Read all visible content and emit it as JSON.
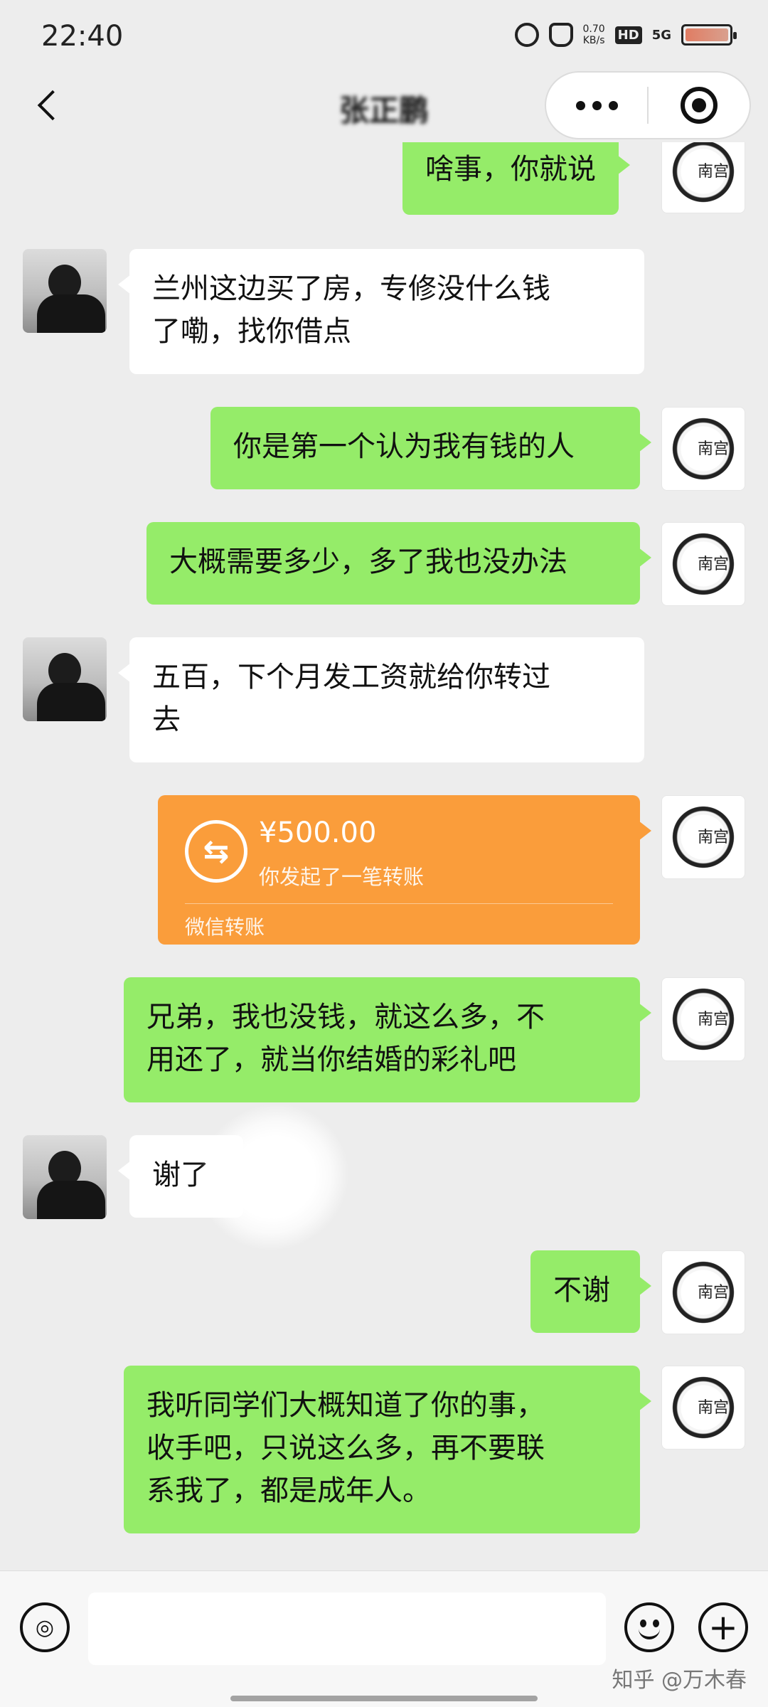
{
  "status_bar": {
    "time": "22:40",
    "speed_value": "0.70",
    "speed_unit": "KB/s",
    "hd": "HD",
    "network": "5G",
    "icons": [
      "alarm-icon",
      "mute-bell-icon",
      "signal-icon",
      "battery-icon"
    ]
  },
  "nav": {
    "title": "张正鹏",
    "back_icon": "chevron-left-icon",
    "more_icon": "more-dots-icon",
    "close_icon": "target-circle-icon"
  },
  "messages": [
    {
      "from": "me",
      "text": "啥事，你就说"
    },
    {
      "from": "friend",
      "line1": "兰州这边买了房，专修没什么钱",
      "line2": "了嘞，找你借点"
    },
    {
      "from": "me",
      "text": "你是第一个认为我有钱的人"
    },
    {
      "from": "me",
      "text": "大概需要多少，多了我也没办法"
    },
    {
      "from": "friend",
      "line1": "五百，下个月发工资就给你转过",
      "line2": "去"
    },
    {
      "from": "me",
      "type": "transfer",
      "amount": "¥500.00",
      "desc": "你发起了一笔转账",
      "brand": "微信转账",
      "icon": "transfer-arrows-icon"
    },
    {
      "from": "me",
      "line1": "兄弟，我也没钱，就这么多，不",
      "line2": "用还了，就当你结婚的彩礼吧"
    },
    {
      "from": "friend",
      "text": "谢了"
    },
    {
      "from": "me",
      "text": "不谢"
    },
    {
      "from": "me",
      "line1": "我听同学们大概知道了你的事，",
      "line2": "收手吧，只说这么多，再不要联",
      "line3": "系我了，都是成年人。"
    }
  ],
  "input_bar": {
    "voice_icon": "voice-icon",
    "emoji_icon": "emoji-icon",
    "plus_icon": "plus-icon",
    "input_value": "",
    "plus_glyph": "+"
  },
  "watermark": "知乎 @万木春",
  "avatar_me_text": "南宫",
  "colors": {
    "background": "#ededed",
    "my_bubble": "#95ec69",
    "friend_bubble": "#ffffff",
    "transfer": "#fa9d3b"
  }
}
